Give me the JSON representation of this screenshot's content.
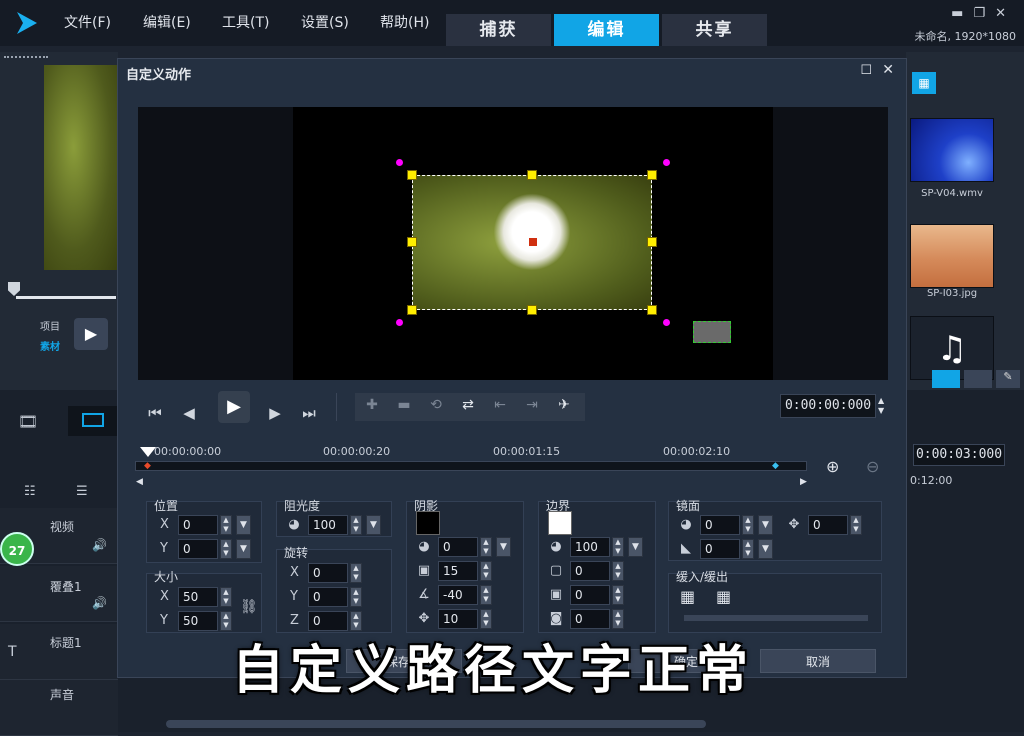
{
  "menu": {
    "file": "文件(F)",
    "edit": "编辑(E)",
    "tools": "工具(T)",
    "settings": "设置(S)",
    "help": "帮助(H)"
  },
  "tabs": {
    "capture": "捕获",
    "edit": "编辑",
    "share": "共享"
  },
  "project": {
    "info": "未命名, 1920*1080"
  },
  "left_panel": {
    "project_label": "项目",
    "clip_label": "素材"
  },
  "library": {
    "items": [
      {
        "label": "SP-V04.wmv"
      },
      {
        "label": "SP-I03.jpg"
      }
    ]
  },
  "dialog": {
    "title": "自定义动作",
    "timecode": "0:00:00:000",
    "ruler": [
      "00:00:00:00",
      "00:00:00:20",
      "00:00:01:15",
      "00:00:02:10"
    ],
    "position": {
      "label": "位置",
      "x": "0",
      "y": "0"
    },
    "size": {
      "label": "大小",
      "x": "50",
      "y": "50"
    },
    "opacity": {
      "label": "阻光度",
      "value": "100"
    },
    "rotation": {
      "label": "旋转",
      "x": "0",
      "y": "0",
      "z": "0"
    },
    "shadow": {
      "label": "阴影",
      "opacity": "0",
      "blur": "15",
      "angle": "-40",
      "distance": "10"
    },
    "border": {
      "label": "边界",
      "opacity": "100",
      "width": "0",
      "corner": "0",
      "blur": "0"
    },
    "mirror": {
      "label": "镜面",
      "opacity": "0",
      "fade": "0",
      "offset": "0"
    },
    "fade": {
      "label": "缓入/缓出"
    },
    "buttons": {
      "save": "保存至",
      "ok": "确定",
      "cancel": "取消"
    }
  },
  "timeline": {
    "timecode": "0:00:03:000",
    "time_marker": "0:12:00",
    "tracks": [
      {
        "name": "视频"
      },
      {
        "name": "覆叠1"
      },
      {
        "name": "标题1"
      },
      {
        "name": "声音"
      }
    ],
    "badge": "27"
  },
  "overlay_text": "自定义路径文字正常",
  "colors": {
    "accent": "#11a5e6",
    "handle": "#ffee00",
    "rotate_handle": "#ff00ff"
  }
}
